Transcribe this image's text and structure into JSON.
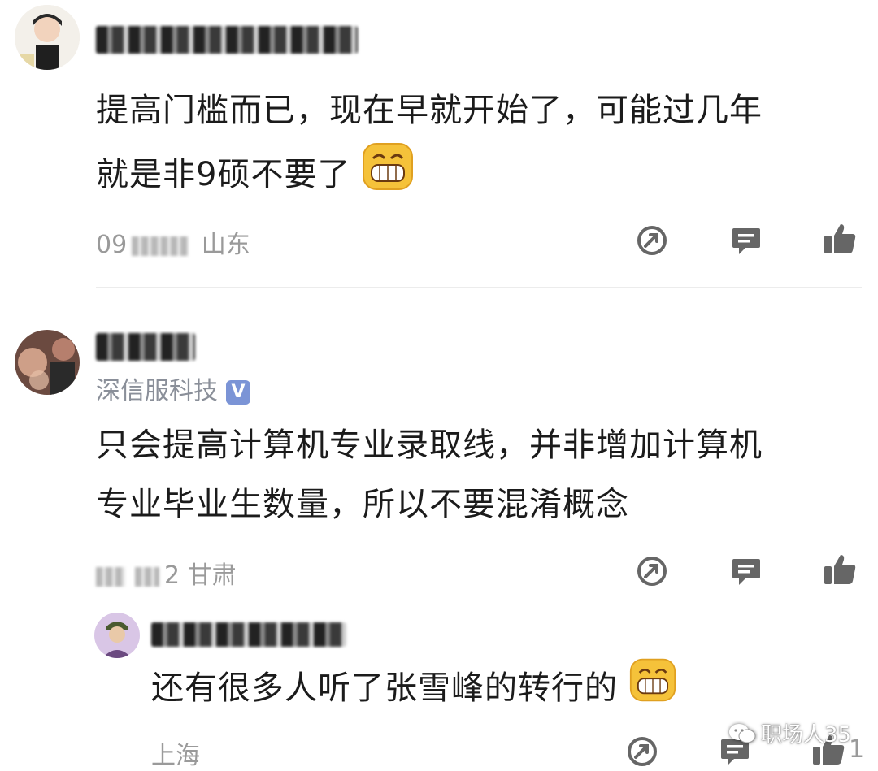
{
  "comments": [
    {
      "line1": "提高门槛而已，现在早就开始了，可能过几年",
      "line2": "就是非9硕不要了",
      "emoji": "grin-emoji",
      "time": "09",
      "region": "山东"
    },
    {
      "company": "深信服科技",
      "verified": "V",
      "line1": "只会提高计算机专业录取线，并非增加计算机",
      "line2": "专业毕业生数量，所以不要混淆概念",
      "time": "09",
      "time2": "2",
      "region": "甘肃"
    },
    {
      "line1": "还有很多人听了张雪峰的转行的",
      "emoji": "grin-emoji",
      "region": "上海",
      "like_count": "1"
    }
  ],
  "watermark": {
    "text": "职场人35"
  },
  "colors": {
    "icon": "#666666",
    "meta": "#9a9a9a",
    "badge": "#7b94d6",
    "emoji": "#f5c23a"
  }
}
